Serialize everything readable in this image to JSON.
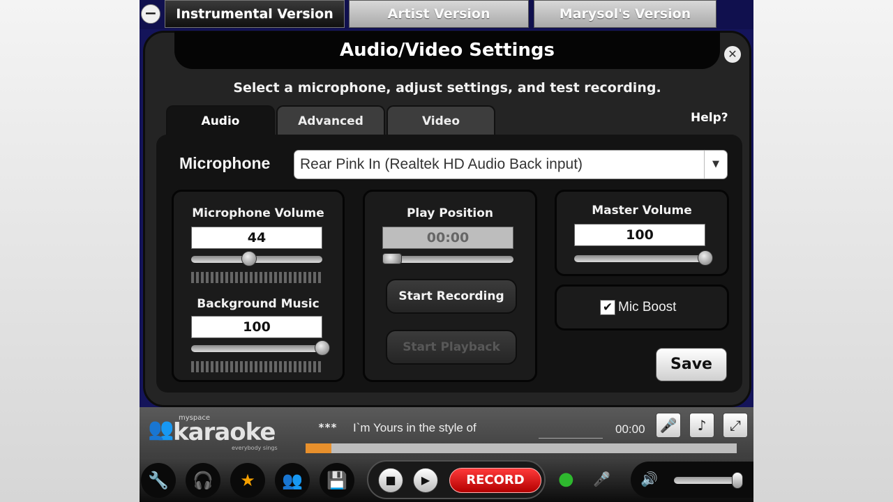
{
  "version_tabs": {
    "minus_icon": "minus-circle-icon",
    "items": [
      {
        "label": "Instrumental Version",
        "active": true
      },
      {
        "label": "Artist Version",
        "active": false
      },
      {
        "label": "Marysol's Version",
        "active": false
      }
    ]
  },
  "dialog": {
    "title": "Audio/Video Settings",
    "close_icon": "close-icon",
    "subtitle": "Select a microphone, adjust settings, and test recording.",
    "tabs": [
      {
        "label": "Audio",
        "active": true
      },
      {
        "label": "Advanced",
        "active": false
      },
      {
        "label": "Video",
        "active": false
      }
    ],
    "help_label": "Help?",
    "microphone": {
      "label": "Microphone",
      "selected": "Rear Pink In (Realtek HD Audio Back input)",
      "arrow_icon": "chevron-down-icon"
    },
    "mic_volume": {
      "label": "Microphone Volume",
      "value": "44",
      "level": 0.44
    },
    "background_music": {
      "label": "Background Music",
      "value": "100",
      "level": 1.0
    },
    "play_position": {
      "label": "Play Position",
      "value": "00:00",
      "level": 0.0
    },
    "start_recording_label": "Start Recording",
    "start_playback_label": "Start Playback",
    "master_volume": {
      "label": "Master Volume",
      "value": "100",
      "level": 1.0
    },
    "mic_boost": {
      "label": "Mic Boost",
      "checked": true
    },
    "save_label": "Save"
  },
  "player": {
    "logo": {
      "small": "myspace",
      "text": "karaoke",
      "tagline": "everybody sings"
    },
    "song": {
      "stars": "***",
      "title": "I`m Yours in the style of",
      "time": "00:00"
    },
    "progress": 0.06,
    "right_buttons": [
      {
        "name": "microphone-icon",
        "glyph": "🎤"
      },
      {
        "name": "music-note-icon",
        "glyph": "♪"
      },
      {
        "name": "fullscreen-icon",
        "glyph": "⤢"
      }
    ],
    "nav_buttons": [
      {
        "name": "wrench-icon",
        "glyph": "🔧"
      },
      {
        "name": "headset-icon",
        "glyph": "🎧"
      },
      {
        "name": "star-icon",
        "glyph": "★"
      },
      {
        "name": "group-icon",
        "glyph": "👥"
      },
      {
        "name": "save-disk-icon",
        "glyph": "💾"
      }
    ],
    "transport": {
      "stop_icon": "stop-icon",
      "play_icon": "play-icon",
      "record_label": "RECORD"
    },
    "webcam_icon": "webcam-icon",
    "mic_status_icon": "mic-icon",
    "volume_icon": "speaker-icon",
    "volume_level": 0.95
  },
  "colors": {
    "app_background": "#14145a",
    "accent_orange": "#f5a000",
    "record_red": "#e01010",
    "webcam_green": "#2eb82e"
  }
}
